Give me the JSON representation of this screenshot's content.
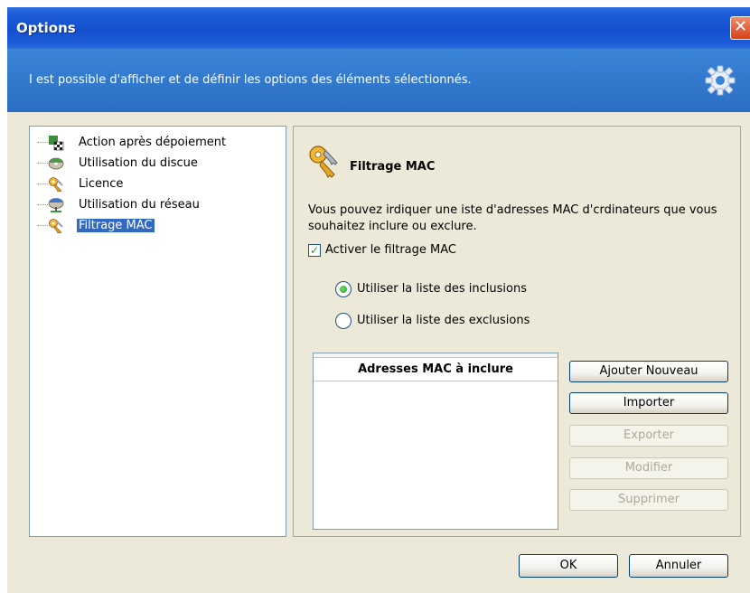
{
  "window": {
    "title": "Options",
    "close_glyph": "✕"
  },
  "header": {
    "text": "I est possible d'afficher et de définir les options des éléments sélectionnés.",
    "icon": "gear-icon"
  },
  "tree": {
    "items": [
      {
        "label": "Action après dépoiement",
        "icon": "checkered-flag-icon",
        "selected": false
      },
      {
        "label": "Utilisation du discue",
        "icon": "disk-icon",
        "selected": false
      },
      {
        "label": "Licence",
        "icon": "keys-icon",
        "selected": false
      },
      {
        "label": "Utilisation du réseau",
        "icon": "network-icon",
        "selected": false
      },
      {
        "label": "Filtrage MAC",
        "icon": "keys-icon",
        "selected": true
      }
    ]
  },
  "content": {
    "title": "Filtrage MAC",
    "description": "Vous pouvez irdiquer une iste d'adresses MAC d'crdinateurs que vous souhaitez inclure ou exclure.",
    "enable_checkbox": {
      "label": "Activer le filtrage MAC",
      "checked": true
    },
    "radio_include": {
      "label": "Utiliser la liste des inclusions",
      "selected": true
    },
    "radio_exclude": {
      "label": "Utiliser la liste des exclusions",
      "selected": false
    },
    "list_header": "Adresses MAC à inclure",
    "buttons": {
      "add": "Ajouter Nouveau",
      "import": "Importer",
      "export": "Exporter",
      "modify": "Modifier",
      "delete": "Supprimer"
    }
  },
  "footer": {
    "ok": "OK",
    "cancel": "Annuler"
  }
}
